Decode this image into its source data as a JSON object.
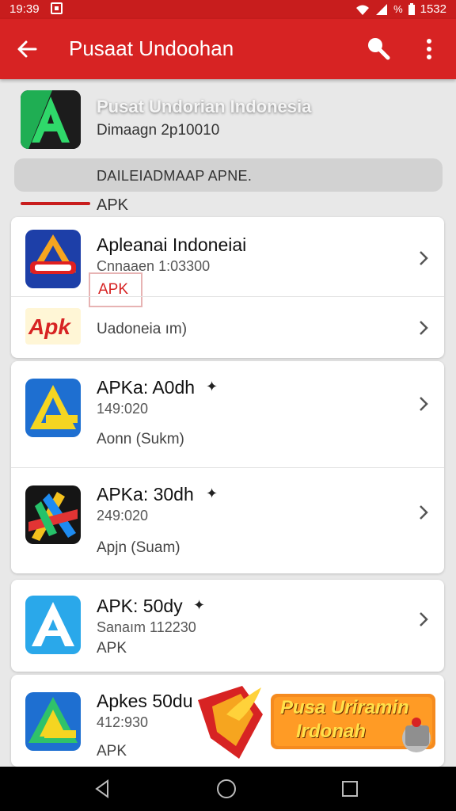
{
  "statusbar": {
    "time": "19:39",
    "battery": "1532"
  },
  "appbar": {
    "title": "Pusaat Undoohan"
  },
  "hero": {
    "name": "Pusat Undorian Indonesia",
    "subtitle": "Dimaagn 2p10010"
  },
  "pill": {
    "text": "DAILEIADMAAP APNE."
  },
  "tab": {
    "label": "APK"
  },
  "cards": [
    {
      "title": "Apleanai Indoneiai",
      "subtitle": "Cnnaaen 1:03300",
      "badge": "APK",
      "row2_icon_text": "Apk",
      "row2_label": "Uadoneia ım)"
    },
    {
      "title": "APKa: A0dh",
      "subtitle": "149:020",
      "tag": "Aonn (Sukm)"
    },
    {
      "title": "APKa: 30dh",
      "subtitle": "249:020",
      "tag": "Apjn (Suam)"
    },
    {
      "title": "APK: 50dy",
      "subtitle": "Sanaım 112230",
      "tag": "APK"
    },
    {
      "title": "Apkes 50du",
      "subtitle": "412:930",
      "tag": "APK"
    }
  ],
  "promo": {
    "line1": "Pusa Uriramin",
    "line2": "Irdonah"
  },
  "colors": {
    "accent": "#d72323",
    "statusbar": "#c81d1d"
  }
}
